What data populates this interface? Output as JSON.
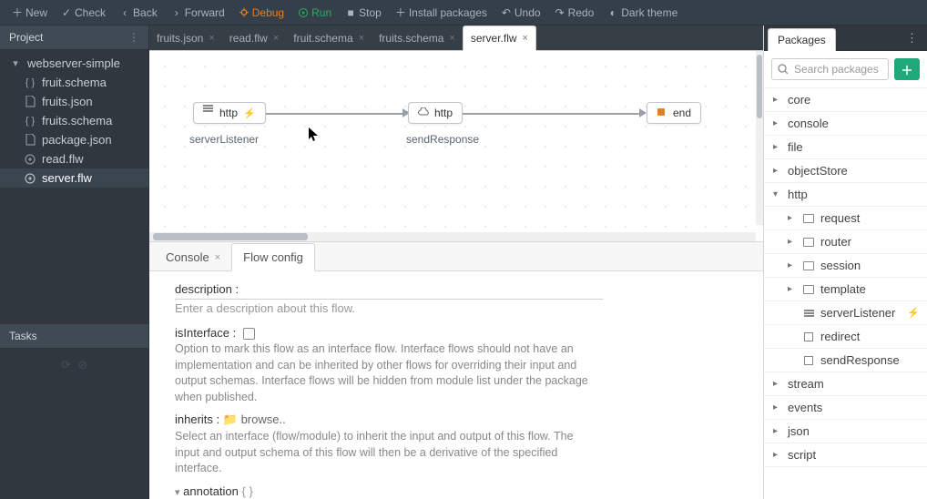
{
  "toolbar": {
    "new_": "New",
    "check": "Check",
    "back": "Back",
    "forward": "Forward",
    "debug": "Debug",
    "run": "Run",
    "stop": "Stop",
    "install": "Install packages",
    "undo": "Undo",
    "redo": "Redo",
    "dark": "Dark theme"
  },
  "project": {
    "title": "Project",
    "root": "webserver-simple",
    "files": [
      {
        "name": "fruit.schema",
        "icon": "{ }"
      },
      {
        "name": "fruits.json",
        "icon": "file"
      },
      {
        "name": "fruits.schema",
        "icon": "{ }"
      },
      {
        "name": "package.json",
        "icon": "file"
      },
      {
        "name": "read.flw",
        "icon": "flow"
      },
      {
        "name": "server.flw",
        "icon": "flow",
        "selected": true
      }
    ]
  },
  "tasks": {
    "title": "Tasks"
  },
  "tabs": [
    {
      "label": "fruits.json"
    },
    {
      "label": "read.flw"
    },
    {
      "label": "fruit.schema"
    },
    {
      "label": "fruits.schema"
    },
    {
      "label": "server.flw",
      "active": true
    }
  ],
  "canvas": {
    "nodes": [
      {
        "id": "serverListener",
        "label": "serverListener",
        "text": "http",
        "trigger": true
      },
      {
        "id": "sendResponse",
        "label": "sendResponse",
        "text": "http"
      },
      {
        "id": "end",
        "label": "",
        "text": "end",
        "end": true
      }
    ]
  },
  "bottomTabs": {
    "console": "Console",
    "flowConfig": "Flow config"
  },
  "config": {
    "description_label": "description :",
    "description_placeholder": "Enter a description about this flow.",
    "isInterface_label": "isInterface :",
    "isInterface_help": "Option to mark this flow as an interface flow. Interface flows should not have an implementation and can be inherited by other flows for overriding their input and output schemas. Interface flows will be hidden from module list under the package when published.",
    "inherits_label": "inherits :",
    "inherits_browse": "browse..",
    "inherits_help": "Select an interface (flow/module) to inherit the input and output of this flow. The input and output schema of this flow will then be a derivative of the specified interface.",
    "annotation_label": "annotation",
    "annotation_value": "{ }"
  },
  "packages": {
    "title": "Packages",
    "search_placeholder": "Search packages",
    "items": [
      {
        "name": "core",
        "open": false
      },
      {
        "name": "console",
        "open": false
      },
      {
        "name": "file",
        "open": false
      },
      {
        "name": "objectStore",
        "open": false
      },
      {
        "name": "http",
        "open": true,
        "children": [
          {
            "name": "request",
            "type": "folder"
          },
          {
            "name": "router",
            "type": "folder"
          },
          {
            "name": "session",
            "type": "folder"
          },
          {
            "name": "template",
            "type": "folder"
          },
          {
            "name": "serverListener",
            "type": "module",
            "trigger": true
          },
          {
            "name": "redirect",
            "type": "module"
          },
          {
            "name": "sendResponse",
            "type": "module"
          }
        ]
      },
      {
        "name": "stream",
        "open": false
      },
      {
        "name": "events",
        "open": false
      },
      {
        "name": "json",
        "open": false
      },
      {
        "name": "script",
        "open": false
      }
    ]
  }
}
